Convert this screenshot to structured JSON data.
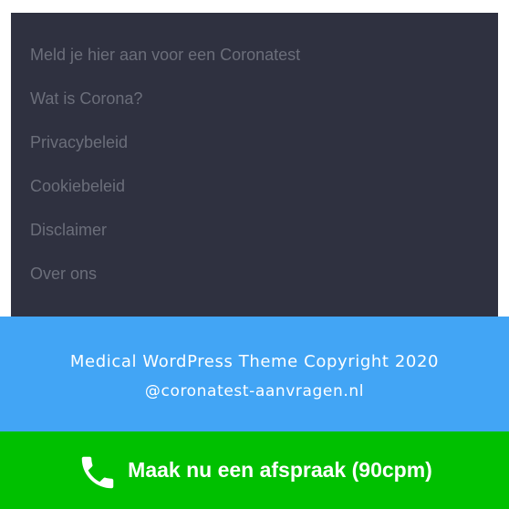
{
  "footer": {
    "links": [
      {
        "label": "Meld je hier aan voor een Coronatest"
      },
      {
        "label": "Wat is Corona?"
      },
      {
        "label": "Privacybeleid"
      },
      {
        "label": "Cookiebeleid"
      },
      {
        "label": "Disclaimer"
      },
      {
        "label": "Over ons"
      }
    ]
  },
  "copyright": {
    "line1": "Medical WordPress Theme Copyright 2020",
    "line2": "@coronatest-aanvragen.nl"
  },
  "cta": {
    "icon": "phone-icon",
    "label": "Maak nu een afspraak (90cpm)"
  },
  "colors": {
    "footer_bg": "#2f3140",
    "link_text": "#6b6e7a",
    "copyright_bg": "#42a5f5",
    "cta_bg": "#00c000"
  }
}
